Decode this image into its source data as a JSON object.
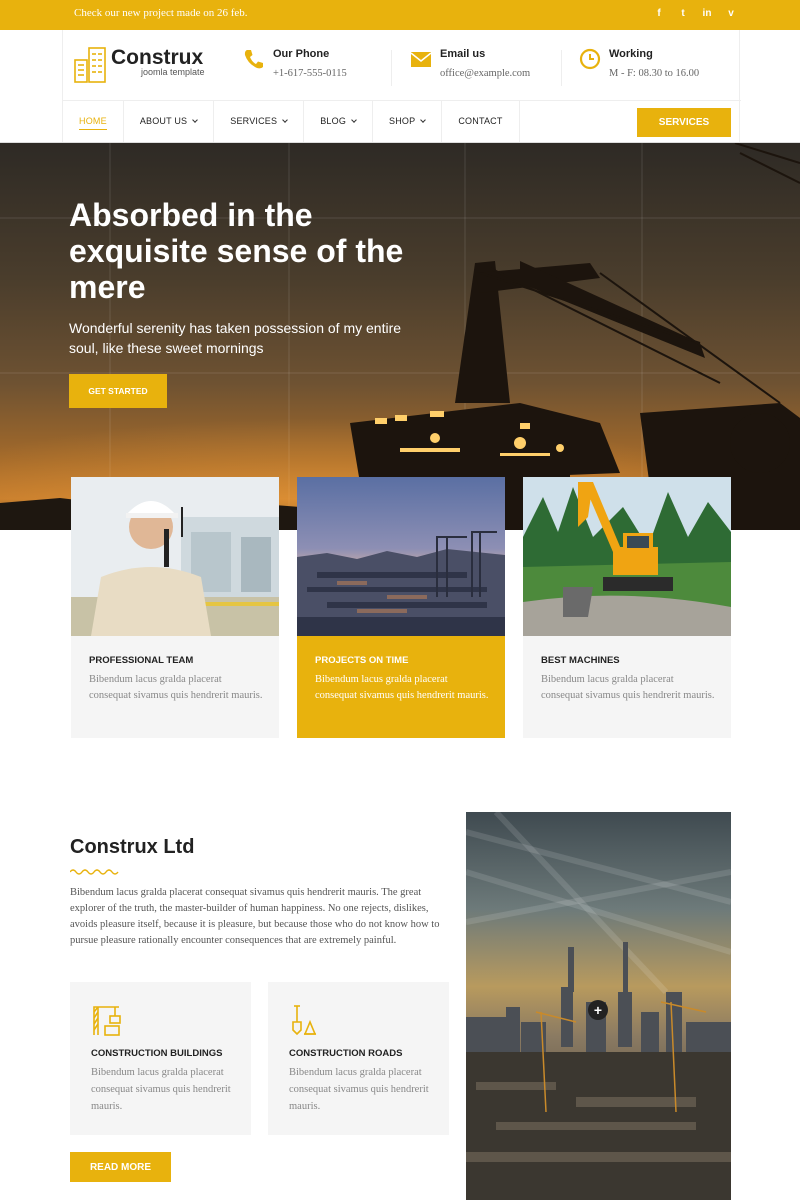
{
  "topbar": {
    "message": "Check our new project made on 26 feb.",
    "social_icons": [
      "facebook-icon",
      "twitter-icon",
      "linkedin-icon",
      "vimeo-icon"
    ],
    "social_glyphs": [
      "f",
      "t",
      "in",
      "v"
    ]
  },
  "brand": {
    "name": "Construx",
    "tagline": "joomla template"
  },
  "contact": {
    "phone": {
      "title": "Our Phone",
      "value": "+1-617-555-0115"
    },
    "email": {
      "title": "Email us",
      "value": "office@example.com"
    },
    "hours": {
      "title": "Working",
      "value": "M - F: 08.30 to 16.00"
    }
  },
  "nav": {
    "items": [
      "HOME",
      "ABOUT US",
      "SERVICES",
      "BLOG",
      "SHOP",
      "CONTACT"
    ],
    "active": "HOME",
    "button": "SERVICES"
  },
  "hero": {
    "title": "Absorbed in the exquisite sense of the mere",
    "subtitle": "Wonderful serenity has taken possession of my entire soul, like these sweet mornings",
    "button": "GET STARTED"
  },
  "cards": [
    {
      "title": "PROFESSIONAL TEAM",
      "text": "Bibendum lacus gralda placerat consequat sivamus quis hendrerit mauris."
    },
    {
      "title": "PROJECTS ON TIME",
      "text": "Bibendum lacus gralda placerat consequat sivamus quis hendrerit mauris."
    },
    {
      "title": "BEST MACHINES",
      "text": "Bibendum lacus gralda placerat consequat sivamus quis hendrerit mauris."
    }
  ],
  "about": {
    "title": "Construx Ltd",
    "text": "Bibendum lacus gralda placerat consequat sivamus quis hendrerit mauris. The great explorer of the truth, the master-builder of human happiness. No one rejects, dislikes, avoids pleasure itself, because it is pleasure, but because those who do not know how to pursue pleasure rationally encounter consequences that are extremely painful.",
    "features": [
      {
        "title": "CONSTRUCTION BUILDINGS",
        "text": "Bibendum lacus gralda placerat consequat sivamus quis hendrerit mauris.",
        "icon": "crane-icon"
      },
      {
        "title": "CONSTRUCTION ROADS",
        "text": "Bibendum lacus gralda placerat consequat sivamus quis hendrerit mauris.",
        "icon": "shovel-cone-icon"
      }
    ],
    "button": "READ MORE",
    "image_overlay": "+"
  },
  "colors": {
    "accent": "#e8b20d",
    "text": "#222222",
    "muted": "#888888",
    "panel": "#f5f5f5"
  }
}
